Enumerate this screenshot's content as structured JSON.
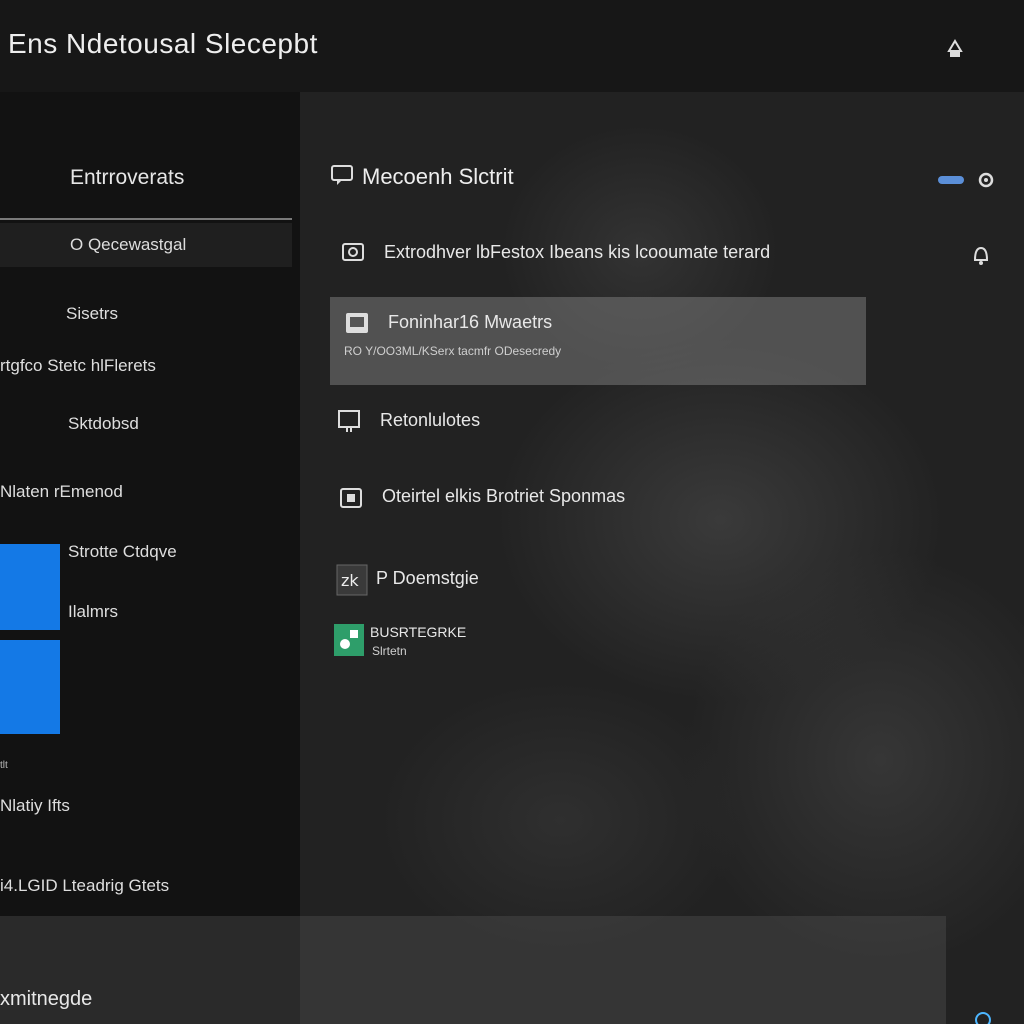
{
  "window": {
    "title": "Ens Ndetousal Slecepbt"
  },
  "sidebar": {
    "heading": "Entrroverats",
    "selected_item": "O Qecewastgal",
    "items": [
      {
        "label": "Sisetrs"
      },
      {
        "label": "rtgfco  Stetc hlFlerets"
      },
      {
        "label": "Sktdobsd"
      },
      {
        "label": "Nlaten  rEmenod"
      },
      {
        "label": "Strotte Ctdqve"
      },
      {
        "label": "Ilalmrs"
      },
      {
        "label": "Nlatiy Ifts"
      },
      {
        "label": "i4.LGID  Lteadrig Gtets"
      }
    ],
    "small_caption": "tlt",
    "bottom_label": "xmitnegde"
  },
  "main": {
    "heading": "Mecoenh Slctrit",
    "rows": [
      {
        "icon": "camera-icon",
        "label": "Extrodhver lbFestox Ibeans kis lcooumate terard",
        "sub": ""
      },
      {
        "icon": "image-icon",
        "label": "Foninhar16 Mwaetrs",
        "sub": "RO  Y/OO3ML/KSerx tacmfr ODesecredy"
      },
      {
        "icon": "shield-icon",
        "label": "Retonlulotes",
        "sub": ""
      },
      {
        "icon": "monitor-icon",
        "label": "Oteirtel elkis Brotriet Sponmas",
        "sub": ""
      },
      {
        "icon": "app-icon",
        "label": "P Doemstgie",
        "sub": ""
      },
      {
        "icon": "store-icon",
        "label": "BUSRTEGRKE",
        "sub": "Slrtetn"
      }
    ]
  },
  "colors": {
    "accent": "#1479e6",
    "toggle": "#5b8fd8",
    "highlight": "#6f6f6f",
    "store": "#2e9e6a"
  }
}
